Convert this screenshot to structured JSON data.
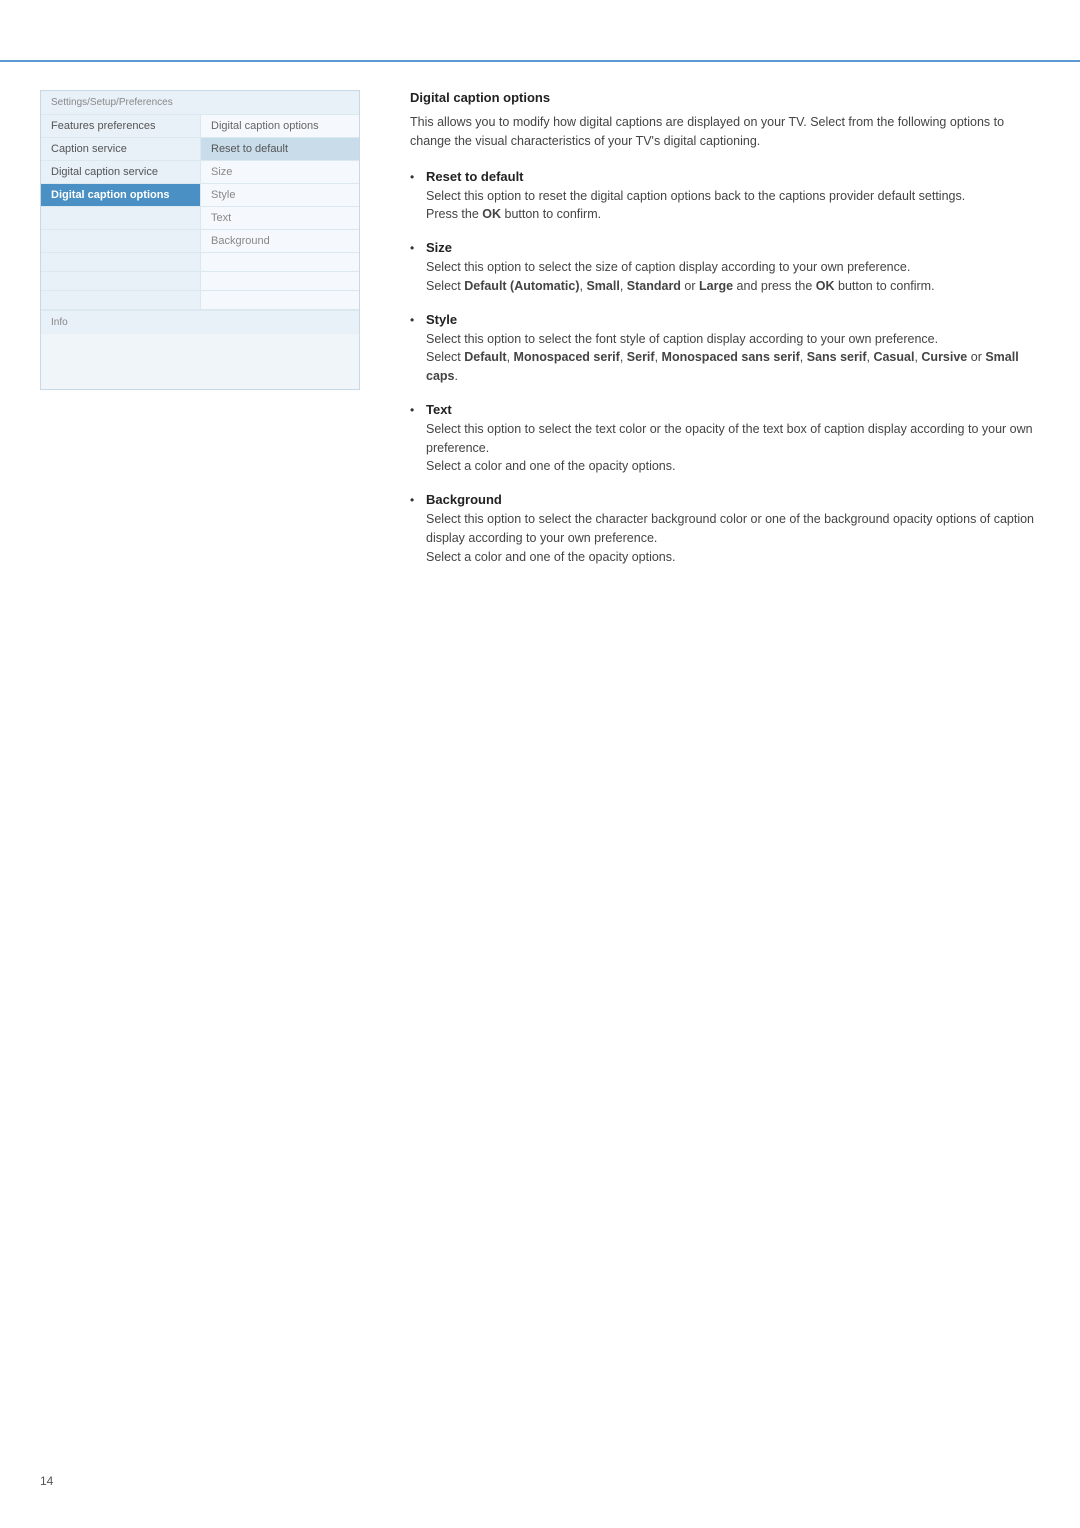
{
  "topBorder": true,
  "leftPanel": {
    "breadcrumb": "Settings/Setup/Preferences",
    "rows": [
      {
        "left": "Features preferences",
        "right": "Digital caption options",
        "leftActive": false,
        "rightActive": false
      },
      {
        "left": "Caption service",
        "right": "Reset to default",
        "leftActive": false,
        "rightActive": true
      },
      {
        "left": "Digital caption service",
        "right": "Size",
        "leftActive": false,
        "rightActive": false
      },
      {
        "left": "Digital caption options",
        "right": "Style",
        "leftActive": true,
        "rightActive": false
      },
      {
        "left": "",
        "right": "Text",
        "leftActive": false,
        "rightActive": false
      },
      {
        "left": "",
        "right": "Background",
        "leftActive": false,
        "rightActive": false
      },
      {
        "left": "",
        "right": "",
        "leftActive": false,
        "rightActive": false
      },
      {
        "left": "",
        "right": "",
        "leftActive": false,
        "rightActive": false
      },
      {
        "left": "",
        "right": "",
        "leftActive": false,
        "rightActive": false
      }
    ],
    "info": "Info"
  },
  "rightPanel": {
    "title": "Digital caption options",
    "intro": "This allows you to modify how digital captions are displayed on your TV. Select from the following options to change the visual characteristics of your TV's digital captioning.",
    "options": [
      {
        "title": "Reset to default",
        "desc": "Select this option to reset the digital caption options back to the captions provider default settings.\nPress the <b>OK</b> button to confirm."
      },
      {
        "title": "Size",
        "desc": "Select this option to select the size of caption display according to your own preference.\nSelect <b>Default (Automatic)</b>, <b>Small</b>, <b>Standard</b> or <b>Large</b> and press the <b>OK</b> button to confirm."
      },
      {
        "title": "Style",
        "desc": "Select this option to select the font style of caption display according to your own preference.\nSelect <b>Default</b>, <b>Monospaced serif</b>, <b>Serif</b>, <b>Monospaced sans serif</b>, <b>Sans serif</b>, <b>Casual</b>, <b>Cursive</b> or <b>Small caps</b>."
      },
      {
        "title": "Text",
        "desc": "Select this option to select the text color or the opacity of the text box of caption display according to your own preference.\nSelect a color and one of the opacity options."
      },
      {
        "title": "Background",
        "desc": "Select this option to select the character background color or one of the background opacity options of caption display according to your own preference.\nSelect a color and one of the opacity options."
      }
    ]
  },
  "pageNumber": "14"
}
